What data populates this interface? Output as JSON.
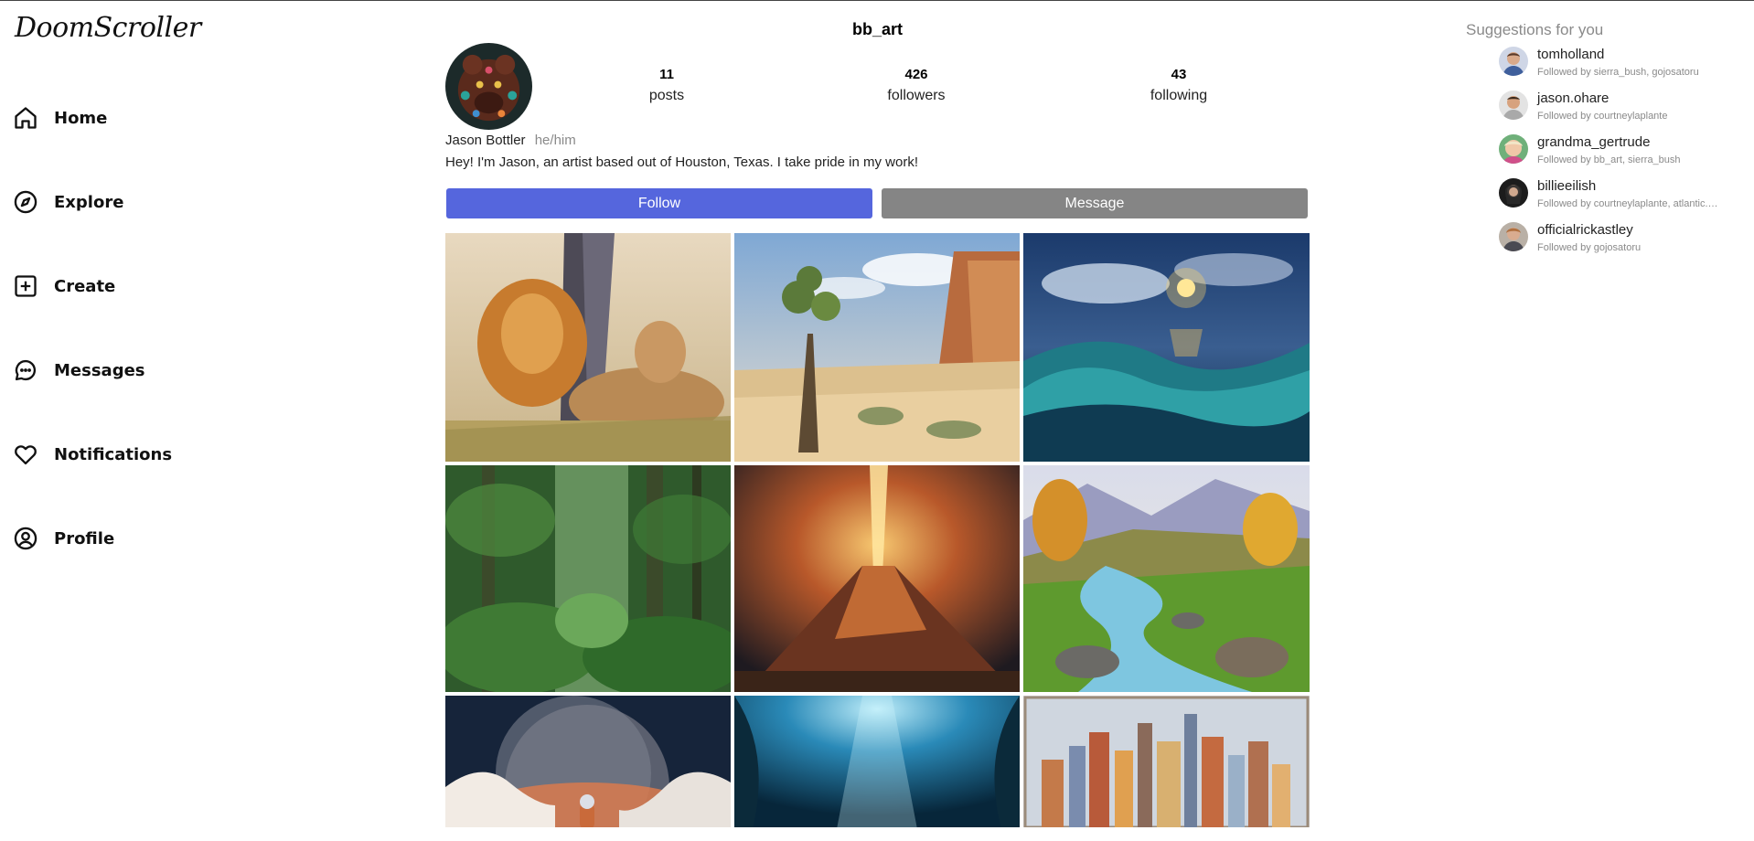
{
  "app": {
    "logo": "DoomScroller"
  },
  "sidebar": {
    "items": [
      {
        "label": "Home",
        "icon": "home-icon"
      },
      {
        "label": "Explore",
        "icon": "compass-icon"
      },
      {
        "label": "Create",
        "icon": "plus-square-icon"
      },
      {
        "label": "Messages",
        "icon": "chat-bubble-icon"
      },
      {
        "label": "Notifications",
        "icon": "heart-icon"
      },
      {
        "label": "Profile",
        "icon": "user-circle-icon"
      }
    ]
  },
  "profile": {
    "username": "bb_art",
    "stats": [
      {
        "value": "11",
        "label": "posts"
      },
      {
        "value": "426",
        "label": "followers"
      },
      {
        "value": "43",
        "label": "following"
      }
    ],
    "display_name": "Jason Bottler",
    "pronouns": "he/him",
    "bio": "Hey! I'm Jason, an artist based out of Houston, Texas. I take pride in my work!",
    "follow_label": "Follow",
    "message_label": "Message",
    "accent_color": "#5566dd",
    "secondary_button_color": "#858585"
  },
  "posts": [
    {
      "subject": "lion-and-lioness-painting"
    },
    {
      "subject": "desert-joshua-tree-painting"
    },
    {
      "subject": "moonlit-ocean-waves-painting"
    },
    {
      "subject": "jungle-forest-painting"
    },
    {
      "subject": "volcano-eruption-painting"
    },
    {
      "subject": "mountain-river-painting"
    },
    {
      "subject": "astronaut-planet-painting"
    },
    {
      "subject": "underwater-light-painting"
    },
    {
      "subject": "city-skyline-painting"
    }
  ],
  "suggestions": {
    "title": "Suggestions for you",
    "items": [
      {
        "username": "tomholland",
        "followed_by": "Followed by sierra_bush, gojosatoru"
      },
      {
        "username": "jason.ohare",
        "followed_by": "Followed by courtneylaplante"
      },
      {
        "username": "grandma_gertrude",
        "followed_by": "Followed by bb_art, sierra_bush"
      },
      {
        "username": "billieeilish",
        "followed_by": "Followed by courtneylaplante, atlantic.fis..."
      },
      {
        "username": "officialrickastley",
        "followed_by": "Followed by gojosatoru"
      }
    ]
  }
}
